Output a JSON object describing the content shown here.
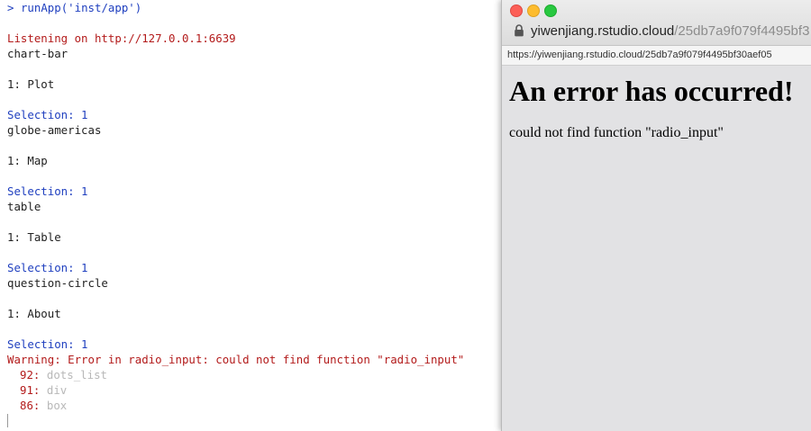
{
  "console": {
    "lines": [
      {
        "prompt": ">",
        "text": "runApp('inst/app')"
      },
      {
        "text": ""
      },
      {
        "text": "Listening on http://127.0.0.1:6639"
      },
      {
        "text": "chart-bar"
      },
      {
        "text": ""
      },
      {
        "text": "1: Plot"
      },
      {
        "text": ""
      },
      {
        "text": "Selection: 1"
      },
      {
        "text": "globe-americas"
      },
      {
        "text": ""
      },
      {
        "text": "1: Map"
      },
      {
        "text": ""
      },
      {
        "text": "Selection: 1"
      },
      {
        "text": "table"
      },
      {
        "text": ""
      },
      {
        "text": "1: Table"
      },
      {
        "text": ""
      },
      {
        "text": "Selection: 1"
      },
      {
        "text": "question-circle"
      },
      {
        "text": ""
      },
      {
        "text": "1: About"
      },
      {
        "text": ""
      },
      {
        "text": "Selection: 1"
      },
      {
        "text": "Warning: Error in radio_input: could not find function \"radio_input\""
      },
      {
        "num": "92:",
        "fn": "dots_list"
      },
      {
        "num": "91:",
        "fn": "div"
      },
      {
        "num": "86:",
        "fn": "box"
      }
    ],
    "colors": {
      "prompt": "#1f3fbf",
      "error": "#b31b1b",
      "selection": "#1f3fbf",
      "text": "#222222",
      "traceback_fn": "#b8b8b8"
    }
  },
  "browser": {
    "title_host": "yiwenjiang.rstudio.cloud",
    "title_path": "/25db7a9f079f4495bf3",
    "address": "https://yiwenjiang.rstudio.cloud/25db7a9f079f4495bf30aef05",
    "lock_icon": "lock-icon",
    "page": {
      "heading": "An error has occurred!",
      "message": "could not find function \"radio_input\""
    }
  }
}
